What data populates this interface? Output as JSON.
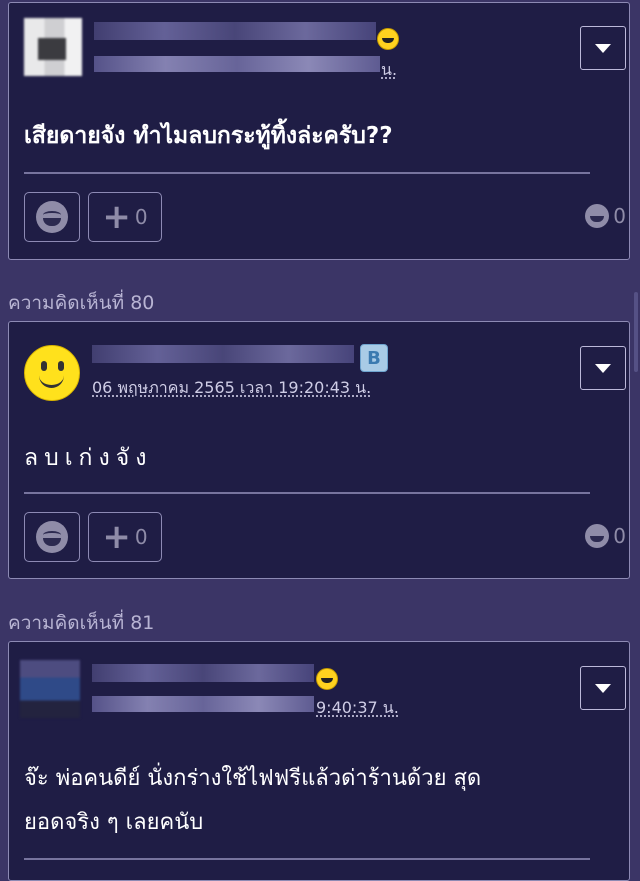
{
  "comments": [
    {
      "timestamp_suffix": "น.",
      "message": "เสียดายจัง ทำไมลบกระทู้ทิ้งล่ะครับ??",
      "plus_count": "0",
      "emotion_count": "0"
    },
    {
      "label": "ความคิดเห็นที่ 80",
      "badge": "B",
      "date": "06 พฤษภาคม 2565 เวลา 19:20:43 น.",
      "message": "ลบเก่งจัง",
      "plus_count": "0",
      "emotion_count": "0"
    },
    {
      "label": "ความคิดเห็นที่ 81",
      "date_partial": "9:40:37 น.",
      "message_line1": "จ๊ะ พ่อคนดีย์ นั่งกร่างใช้ไฟฟรีแล้วด่าร้านด้วย สุด",
      "message_line2": "ยอดจริง ๆ เลยคนับ"
    }
  ],
  "colors": {
    "background": "#3b3566",
    "card": "#1f1d45",
    "accent_yellow": "#ffd21f"
  }
}
